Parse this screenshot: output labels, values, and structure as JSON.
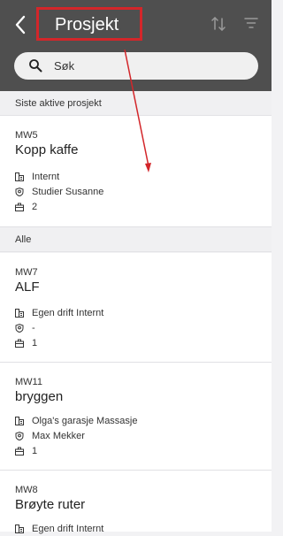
{
  "header": {
    "title": "Prosjekt",
    "search_placeholder": "Søk"
  },
  "sections": {
    "recent_label": "Siste aktive prosjekt",
    "all_label": "Alle"
  },
  "projects": [
    {
      "code": "MW5",
      "name": "Kopp kaffe",
      "customer": "Internt",
      "responsible": "Studier Susanne",
      "count": "2"
    },
    {
      "code": "MW7",
      "name": "ALF",
      "customer": "Egen drift Internt",
      "responsible": "-",
      "count": "1"
    },
    {
      "code": "MW11",
      "name": "bryggen",
      "customer": "Olga's garasje Massasje",
      "responsible": "Max Mekker",
      "count": "1"
    },
    {
      "code": "MW8",
      "name": "Brøyte ruter",
      "customer": "Egen drift Internt"
    }
  ],
  "colors": {
    "header_bg": "#4f4f4f",
    "highlight": "#d3262a"
  },
  "icons": [
    "back-chevron-icon",
    "sort-icon",
    "filter-icon",
    "search-icon",
    "building-icon",
    "shield-icon",
    "briefcase-icon"
  ]
}
